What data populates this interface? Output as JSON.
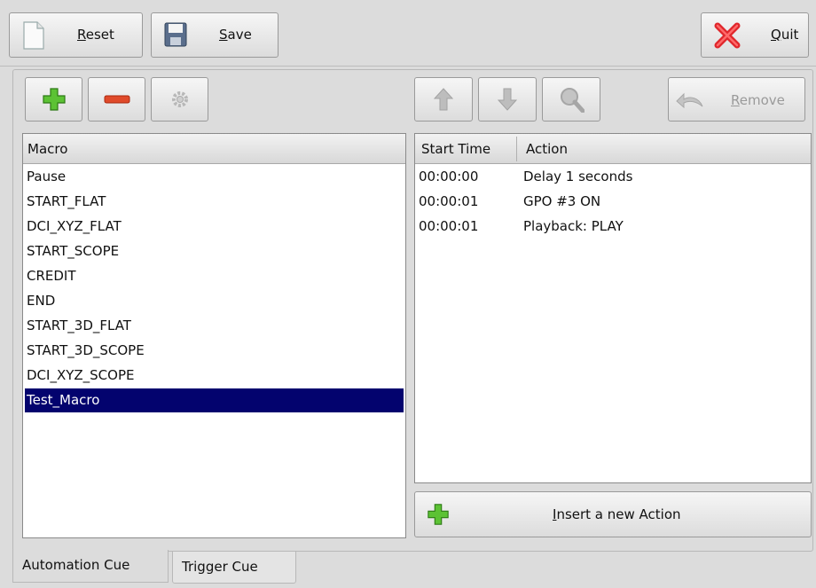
{
  "toolbar": {
    "reset": {
      "mnemonic": "R",
      "rest": "eset"
    },
    "save": {
      "mnemonic": "S",
      "rest": "ave"
    },
    "quit": {
      "mnemonic": "Q",
      "rest": "uit"
    }
  },
  "macro_list": {
    "header": "Macro",
    "items": [
      "Pause",
      "START_FLAT",
      "DCI_XYZ_FLAT",
      "START_SCOPE",
      "CREDIT",
      "END",
      "START_3D_FLAT",
      "START_3D_SCOPE",
      "DCI_XYZ_SCOPE",
      "Test_Macro"
    ],
    "selected": "Test_Macro"
  },
  "actions": {
    "remove": {
      "mnemonic": "R",
      "rest": "emove"
    },
    "headers": [
      "Start Time",
      "Action"
    ],
    "rows": [
      {
        "time": "00:00:00",
        "action": "Delay 1 seconds"
      },
      {
        "time": "00:00:01",
        "action": "GPO #3 ON"
      },
      {
        "time": "00:00:01",
        "action": "Playback: PLAY"
      }
    ],
    "insert": {
      "mnemonic": "I",
      "rest": "nsert a new Action"
    }
  },
  "tabs": [
    {
      "label": "Automation Cue",
      "active": true
    },
    {
      "label": "Trigger Cue",
      "active": false
    }
  ],
  "colors": {
    "selection": "#03036e",
    "add_icon": "#3aa21a",
    "remove_icon": "#e04a2a",
    "quit_icon": "#e0262b"
  }
}
